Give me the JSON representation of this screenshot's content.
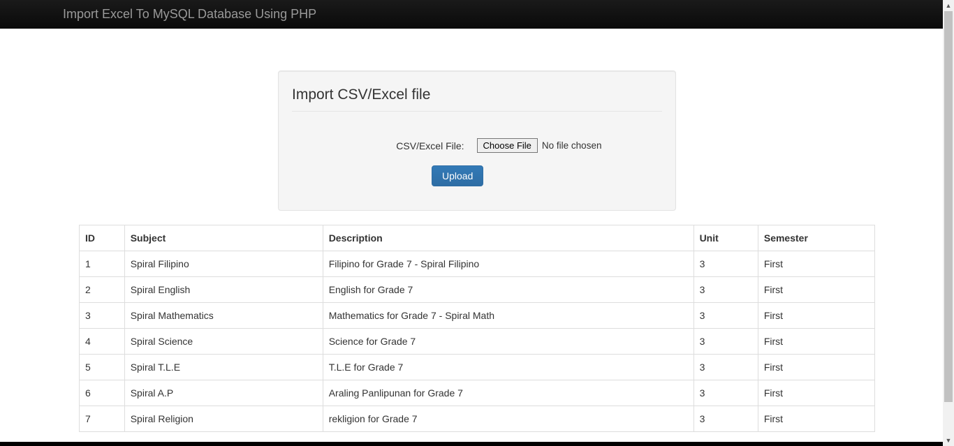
{
  "navbar": {
    "brand": "Import Excel To MySQL Database Using PHP"
  },
  "importPanel": {
    "legend": "Import CSV/Excel file",
    "fileLabel": "CSV/Excel File:",
    "chooseFileButton": "Choose File",
    "fileStatus": "No file chosen",
    "uploadButton": "Upload"
  },
  "table": {
    "headers": [
      "ID",
      "Subject",
      "Description",
      "Unit",
      "Semester"
    ],
    "rows": [
      {
        "id": "1",
        "subject": "Spiral Filipino",
        "description": "Filipino for Grade 7 - Spiral Filipino",
        "unit": "3",
        "semester": "First"
      },
      {
        "id": "2",
        "subject": "Spiral English",
        "description": "English for Grade 7",
        "unit": "3",
        "semester": "First"
      },
      {
        "id": "3",
        "subject": "Spiral Mathematics",
        "description": "Mathematics for Grade 7 - Spiral Math",
        "unit": "3",
        "semester": "First"
      },
      {
        "id": "4",
        "subject": "Spiral Science",
        "description": "Science for Grade 7",
        "unit": "3",
        "semester": "First"
      },
      {
        "id": "5",
        "subject": "Spiral T.L.E",
        "description": "T.L.E for Grade 7",
        "unit": "3",
        "semester": "First"
      },
      {
        "id": "6",
        "subject": "Spiral A.P",
        "description": "Araling Panlipunan for Grade 7",
        "unit": "3",
        "semester": "First"
      },
      {
        "id": "7",
        "subject": "Spiral Religion",
        "description": "rekligion for Grade 7",
        "unit": "3",
        "semester": "First"
      }
    ]
  }
}
